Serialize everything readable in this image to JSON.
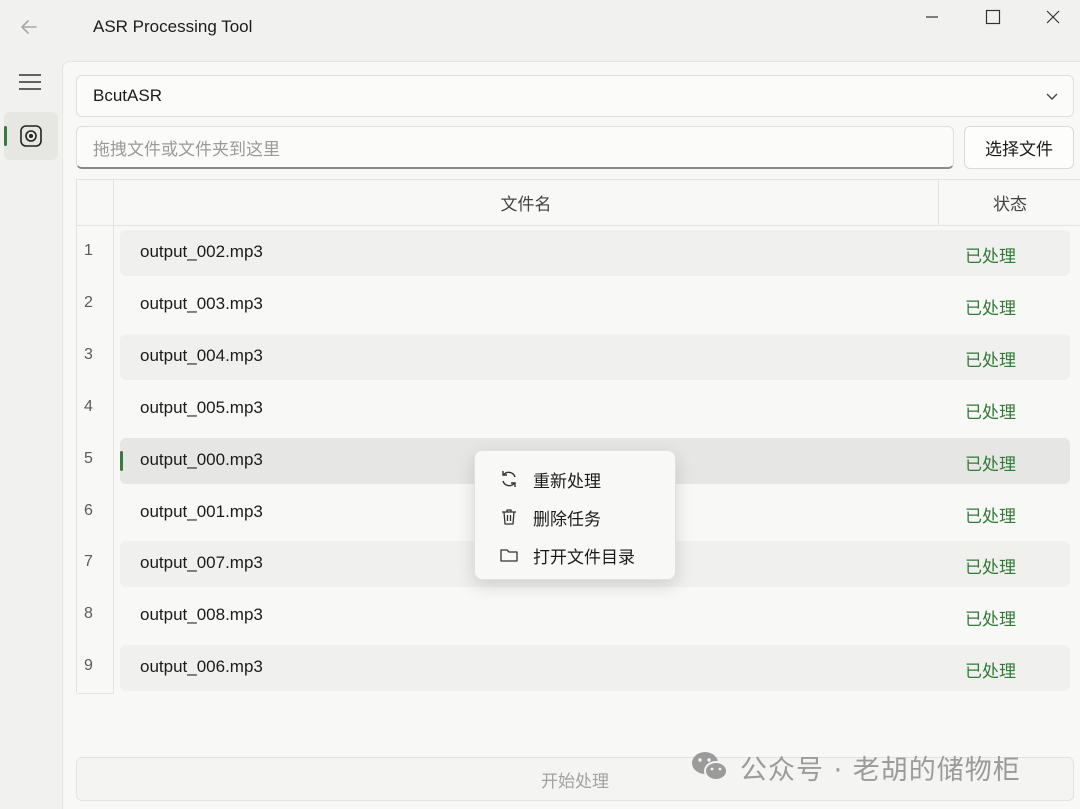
{
  "window": {
    "title": "ASR Processing Tool"
  },
  "icons": {
    "back": "arrow-left-icon",
    "menu": "hamburger-menu-icon",
    "nav_item": "record-icon",
    "minimize": "minimize-icon",
    "maximize": "maximize-icon",
    "close": "close-icon",
    "dropdown": "chevron-down-icon"
  },
  "engine_select": {
    "value": "BcutASR"
  },
  "file_drop": {
    "placeholder": "拖拽文件或文件夹到这里"
  },
  "choose_file_button": {
    "label": "选择文件"
  },
  "table": {
    "columns": [
      "文件名",
      "状态"
    ],
    "rows": [
      {
        "index": "1",
        "file": "output_002.mp3",
        "status": "已处理"
      },
      {
        "index": "2",
        "file": "output_003.mp3",
        "status": "已处理"
      },
      {
        "index": "3",
        "file": "output_004.mp3",
        "status": "已处理"
      },
      {
        "index": "4",
        "file": "output_005.mp3",
        "status": "已处理"
      },
      {
        "index": "5",
        "file": "output_000.mp3",
        "status": "已处理"
      },
      {
        "index": "6",
        "file": "output_001.mp3",
        "status": "已处理"
      },
      {
        "index": "7",
        "file": "output_007.mp3",
        "status": "已处理"
      },
      {
        "index": "8",
        "file": "output_008.mp3",
        "status": "已处理"
      },
      {
        "index": "9",
        "file": "output_006.mp3",
        "status": "已处理"
      }
    ],
    "selected_row": 5
  },
  "context_menu": {
    "items": [
      {
        "label": "重新处理",
        "icon": "refresh-icon"
      },
      {
        "label": "删除任务",
        "icon": "trash-icon"
      },
      {
        "label": "打开文件目录",
        "icon": "folder-icon"
      }
    ]
  },
  "start_button": {
    "label": "开始处理"
  },
  "watermark": {
    "text": "公众号 · 老胡的储物柜",
    "icon": "wechat-icon"
  },
  "colors": {
    "accent": "#3b7a3f",
    "status_text": "#2f7a34",
    "background": "#f1f1ef"
  }
}
